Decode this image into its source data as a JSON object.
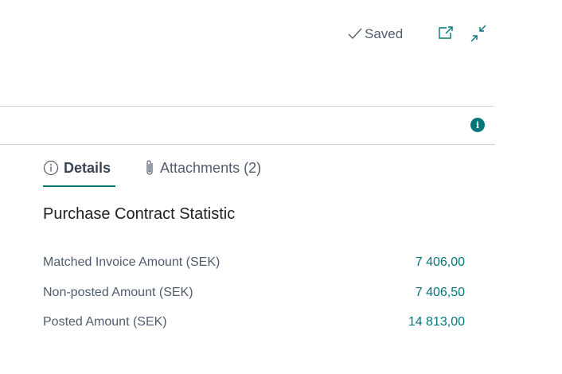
{
  "header": {
    "saved_label": "Saved",
    "icons": [
      "checkmark-icon",
      "open-in-new-window-icon",
      "collapse-icon"
    ]
  },
  "info_badge": "i",
  "tabs": [
    {
      "label": "Details",
      "icon": "info-circle-icon",
      "active": true
    },
    {
      "label": "Attachments (2)",
      "icon": "paperclip-icon",
      "active": false
    }
  ],
  "section": {
    "title": "Purchase Contract Statistic",
    "rows": [
      {
        "label": "Matched Invoice Amount (SEK)",
        "value": "7 406,00"
      },
      {
        "label": "Non-posted Amount (SEK)",
        "value": "7 406,50"
      },
      {
        "label": "Posted Amount (SEK)",
        "value": "14 813,00"
      }
    ]
  },
  "colors": {
    "accent": "#00767a",
    "text_muted": "#505c6d",
    "text_dark": "#212121",
    "divider": "#d4d4d4"
  }
}
